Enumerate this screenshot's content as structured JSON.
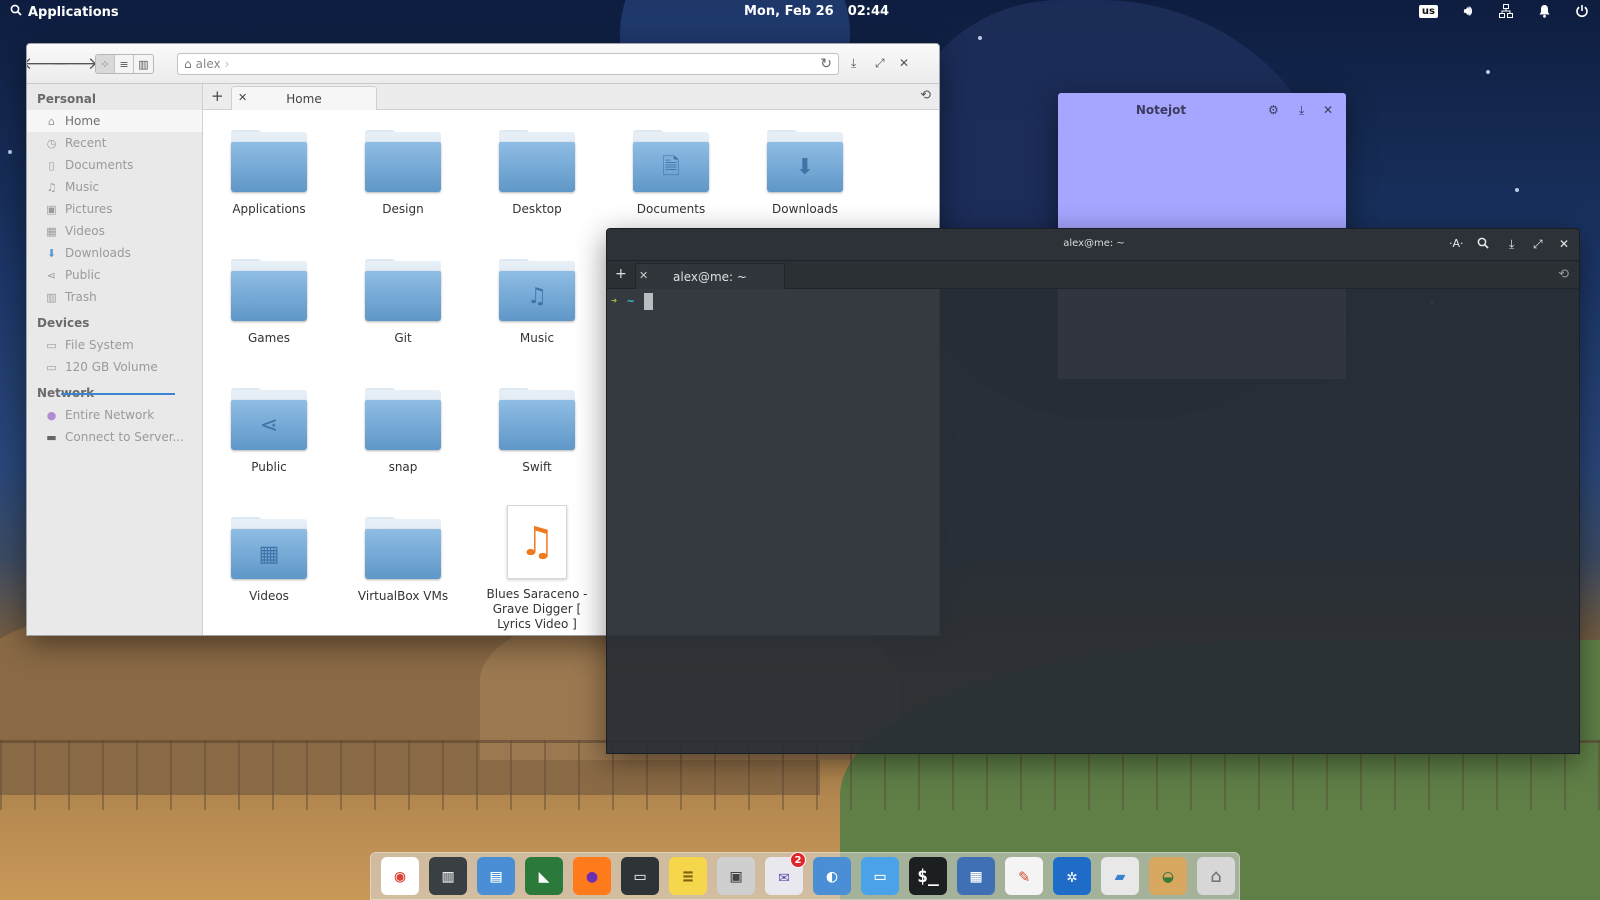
{
  "topbar": {
    "applications_label": "Applications",
    "date": "Mon, Feb 26",
    "time": "02:44",
    "keyboard_layout": "us",
    "icons": [
      "volume-icon",
      "network-icon",
      "notifications-icon",
      "power-icon"
    ]
  },
  "files": {
    "path_segment": "alex",
    "sidebar": {
      "personal_heading": "Personal",
      "personal_items": [
        {
          "label": "Home",
          "icon": "home-icon"
        },
        {
          "label": "Recent",
          "icon": "recent-icon"
        },
        {
          "label": "Documents",
          "icon": "documents-icon"
        },
        {
          "label": "Music",
          "icon": "music-icon"
        },
        {
          "label": "Pictures",
          "icon": "pictures-icon"
        },
        {
          "label": "Videos",
          "icon": "videos-icon"
        },
        {
          "label": "Downloads",
          "icon": "downloads-icon"
        },
        {
          "label": "Public",
          "icon": "share-icon"
        },
        {
          "label": "Trash",
          "icon": "trash-icon"
        }
      ],
      "devices_heading": "Devices",
      "device_items": [
        {
          "label": "File System",
          "icon": "drive-icon"
        },
        {
          "label": "120 GB Volume",
          "icon": "drive-icon"
        }
      ],
      "network_heading": "Network",
      "network_items": [
        {
          "label": "Entire Network",
          "icon": "network-icon"
        },
        {
          "label": "Connect to Server...",
          "icon": "server-icon"
        }
      ]
    },
    "tab_label": "Home",
    "items": [
      {
        "label": "Applications",
        "kind": "folder",
        "emblem": ""
      },
      {
        "label": "Design",
        "kind": "folder",
        "emblem": ""
      },
      {
        "label": "Desktop",
        "kind": "folder",
        "emblem": ""
      },
      {
        "label": "Documents",
        "kind": "folder",
        "emblem": "🗎"
      },
      {
        "label": "Downloads",
        "kind": "folder",
        "emblem": "⬇"
      },
      {
        "label": "Games",
        "kind": "folder",
        "emblem": ""
      },
      {
        "label": "Git",
        "kind": "folder",
        "emblem": ""
      },
      {
        "label": "Music",
        "kind": "folder",
        "emblem": "♫"
      },
      {
        "label": "Public",
        "kind": "folder",
        "emblem": "⋖"
      },
      {
        "label": "snap",
        "kind": "folder",
        "emblem": ""
      },
      {
        "label": "Swift",
        "kind": "folder",
        "emblem": ""
      },
      {
        "label": "Videos",
        "kind": "folder",
        "emblem": "▦"
      },
      {
        "label": "VirtualBox VMs",
        "kind": "folder",
        "emblem": ""
      },
      {
        "label": "Blues Saraceno - Grave Digger [ Lyrics Video ]",
        "kind": "music-file",
        "emblem": "♫"
      }
    ]
  },
  "notejot": {
    "title": "Notejot"
  },
  "terminal": {
    "title": "alex@me: ~",
    "tab_label": "alex@me: ~",
    "prompt_arrow": "➜",
    "prompt_dir": "~"
  },
  "dock": {
    "apps": [
      {
        "name": "chrome",
        "color": "#ffffff",
        "glyph": "◉",
        "fg": "#db4437"
      },
      {
        "name": "file-compare",
        "color": "#3a3f44",
        "glyph": "▥",
        "fg": "#e8e8e8"
      },
      {
        "name": "file-cabinet",
        "color": "#4a8fd6",
        "glyph": "▤",
        "fg": "#ffffff"
      },
      {
        "name": "visual-studio-code",
        "color": "#2b7a3b",
        "glyph": "◣",
        "fg": "#ffffff"
      },
      {
        "name": "firefox",
        "color": "#ff7a1a",
        "glyph": "●",
        "fg": "#6b2fb3"
      },
      {
        "name": "screenshot",
        "color": "#2e3338",
        "glyph": "▭",
        "fg": "#dcdcdc"
      },
      {
        "name": "notes",
        "color": "#f6d64b",
        "glyph": "≡",
        "fg": "#7a6210"
      },
      {
        "name": "window-builder",
        "color": "#cfcfcf",
        "glyph": "▣",
        "fg": "#444444"
      },
      {
        "name": "mail",
        "color": "#e8e8ee",
        "glyph": "✉",
        "fg": "#5b4aa8",
        "badge": "2"
      },
      {
        "name": "switchboard",
        "color": "#4a8fd6",
        "glyph": "◐",
        "fg": "#ffffff"
      },
      {
        "name": "desktop",
        "color": "#4aa3e8",
        "glyph": "▭",
        "fg": "#ffffff"
      },
      {
        "name": "terminal",
        "color": "#1c1f22",
        "glyph": "$_",
        "fg": "#ffffff"
      },
      {
        "name": "multitasking",
        "color": "#3f6fb5",
        "glyph": "▦",
        "fg": "#ffffff"
      },
      {
        "name": "text-editor",
        "color": "#f4f4f4",
        "glyph": "✎",
        "fg": "#d24a2a"
      },
      {
        "name": "web-browser",
        "color": "#1e6cc8",
        "glyph": "✲",
        "fg": "#ffffff"
      },
      {
        "name": "app-center",
        "color": "#e8e8e8",
        "glyph": "▰",
        "fg": "#3b7fd1"
      },
      {
        "name": "photos",
        "color": "#d9a860",
        "glyph": "◒",
        "fg": "#3b7a3b"
      },
      {
        "name": "home-folder",
        "color": "#d7d7d7",
        "glyph": "⌂",
        "fg": "#777777"
      }
    ]
  }
}
